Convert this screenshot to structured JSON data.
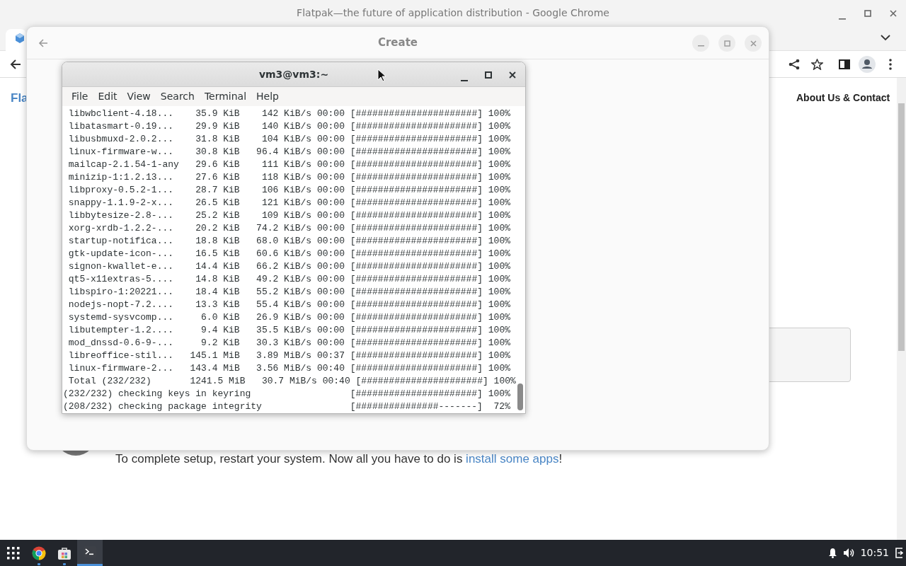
{
  "browser": {
    "title": "Flatpak—the future of application distribution - Google Chrome",
    "page": {
      "brand_partial": "Fla",
      "nav_link": "About Us & Contact",
      "setup_text": "To complete setup, restart your system. Now all you have to do is ",
      "setup_link": "install some apps",
      "setup_end": "!"
    }
  },
  "dialog": {
    "title": "Create"
  },
  "terminal": {
    "title": "vm3@vm3:~",
    "menu": [
      "File",
      "Edit",
      "View",
      "Search",
      "Terminal",
      "Help"
    ],
    "rows": [
      {
        "name": "libwbclient-4.18...",
        "size": "35.9 KiB",
        "speed": "142 KiB/s",
        "time": "00:00",
        "bar": "[######################]",
        "percent": "100%"
      },
      {
        "name": "libatasmart-0.19...",
        "size": "29.9 KiB",
        "speed": "140 KiB/s",
        "time": "00:00",
        "bar": "[######################]",
        "percent": "100%"
      },
      {
        "name": "libusbmuxd-2.0.2...",
        "size": "31.8 KiB",
        "speed": "104 KiB/s",
        "time": "00:00",
        "bar": "[######################]",
        "percent": "100%"
      },
      {
        "name": "linux-firmware-w...",
        "size": "30.8 KiB",
        "speed": "96.4 KiB/s",
        "time": "00:00",
        "bar": "[######################]",
        "percent": "100%"
      },
      {
        "name": "mailcap-2.1.54-1-any",
        "size": "29.6 KiB",
        "speed": "111 KiB/s",
        "time": "00:00",
        "bar": "[######################]",
        "percent": "100%"
      },
      {
        "name": "minizip-1:1.2.13...",
        "size": "27.6 KiB",
        "speed": "118 KiB/s",
        "time": "00:00",
        "bar": "[######################]",
        "percent": "100%"
      },
      {
        "name": "libproxy-0.5.2-1...",
        "size": "28.7 KiB",
        "speed": "106 KiB/s",
        "time": "00:00",
        "bar": "[######################]",
        "percent": "100%"
      },
      {
        "name": "snappy-1.1.9-2-x...",
        "size": "26.5 KiB",
        "speed": "121 KiB/s",
        "time": "00:00",
        "bar": "[######################]",
        "percent": "100%"
      },
      {
        "name": "libbytesize-2.8-...",
        "size": "25.2 KiB",
        "speed": "109 KiB/s",
        "time": "00:00",
        "bar": "[######################]",
        "percent": "100%"
      },
      {
        "name": "xorg-xrdb-1.2.2-...",
        "size": "20.2 KiB",
        "speed": "74.2 KiB/s",
        "time": "00:00",
        "bar": "[######################]",
        "percent": "100%"
      },
      {
        "name": "startup-notifica...",
        "size": "18.8 KiB",
        "speed": "68.0 KiB/s",
        "time": "00:00",
        "bar": "[######################]",
        "percent": "100%"
      },
      {
        "name": "gtk-update-icon-...",
        "size": "16.5 KiB",
        "speed": "60.6 KiB/s",
        "time": "00:00",
        "bar": "[######################]",
        "percent": "100%"
      },
      {
        "name": "signon-kwallet-e...",
        "size": "14.4 KiB",
        "speed": "66.2 KiB/s",
        "time": "00:00",
        "bar": "[######################]",
        "percent": "100%"
      },
      {
        "name": "qt5-x11extras-5....",
        "size": "14.8 KiB",
        "speed": "49.2 KiB/s",
        "time": "00:00",
        "bar": "[######################]",
        "percent": "100%"
      },
      {
        "name": "libspiro-1:20221...",
        "size": "18.4 KiB",
        "speed": "55.2 KiB/s",
        "time": "00:00",
        "bar": "[######################]",
        "percent": "100%"
      },
      {
        "name": "nodejs-nopt-7.2....",
        "size": "13.3 KiB",
        "speed": "55.4 KiB/s",
        "time": "00:00",
        "bar": "[######################]",
        "percent": "100%"
      },
      {
        "name": "systemd-sysvcomp...",
        "size": "6.0 KiB",
        "speed": "26.9 KiB/s",
        "time": "00:00",
        "bar": "[######################]",
        "percent": "100%"
      },
      {
        "name": "libutempter-1.2....",
        "size": "9.4 KiB",
        "speed": "35.5 KiB/s",
        "time": "00:00",
        "bar": "[######################]",
        "percent": "100%"
      },
      {
        "name": "mod_dnssd-0.6-9-...",
        "size": "9.2 KiB",
        "speed": "30.3 KiB/s",
        "time": "00:00",
        "bar": "[######################]",
        "percent": "100%"
      },
      {
        "name": "libreoffice-stil...",
        "size": "145.1 MiB",
        "speed": "3.89 MiB/s",
        "time": "00:37",
        "bar": "[######################]",
        "percent": "100%"
      },
      {
        "name": "linux-firmware-2...",
        "size": "143.4 MiB",
        "speed": "3.56 MiB/s",
        "time": "00:40",
        "bar": "[######################]",
        "percent": "100%"
      },
      {
        "name": "Total (232/232)",
        "size": "1241.5 MiB",
        "speed": "30.7 MiB/s",
        "time": "00:40",
        "bar": "[######################]",
        "percent": "100%"
      }
    ],
    "status_rows": [
      {
        "label": "(232/232) checking keys in keyring",
        "bar": "[######################]",
        "percent": "100%"
      },
      {
        "label": "(208/232) checking package integrity",
        "bar": "[###############-------]",
        "percent": "72%"
      }
    ]
  },
  "taskbar": {
    "apps": [
      {
        "kind": "launcher",
        "selected": false,
        "running": false
      },
      {
        "kind": "browser",
        "selected": false,
        "running": true
      },
      {
        "kind": "store",
        "selected": false,
        "running": true
      },
      {
        "kind": "terminal",
        "selected": true,
        "running": false
      }
    ],
    "clock": "10:51"
  }
}
